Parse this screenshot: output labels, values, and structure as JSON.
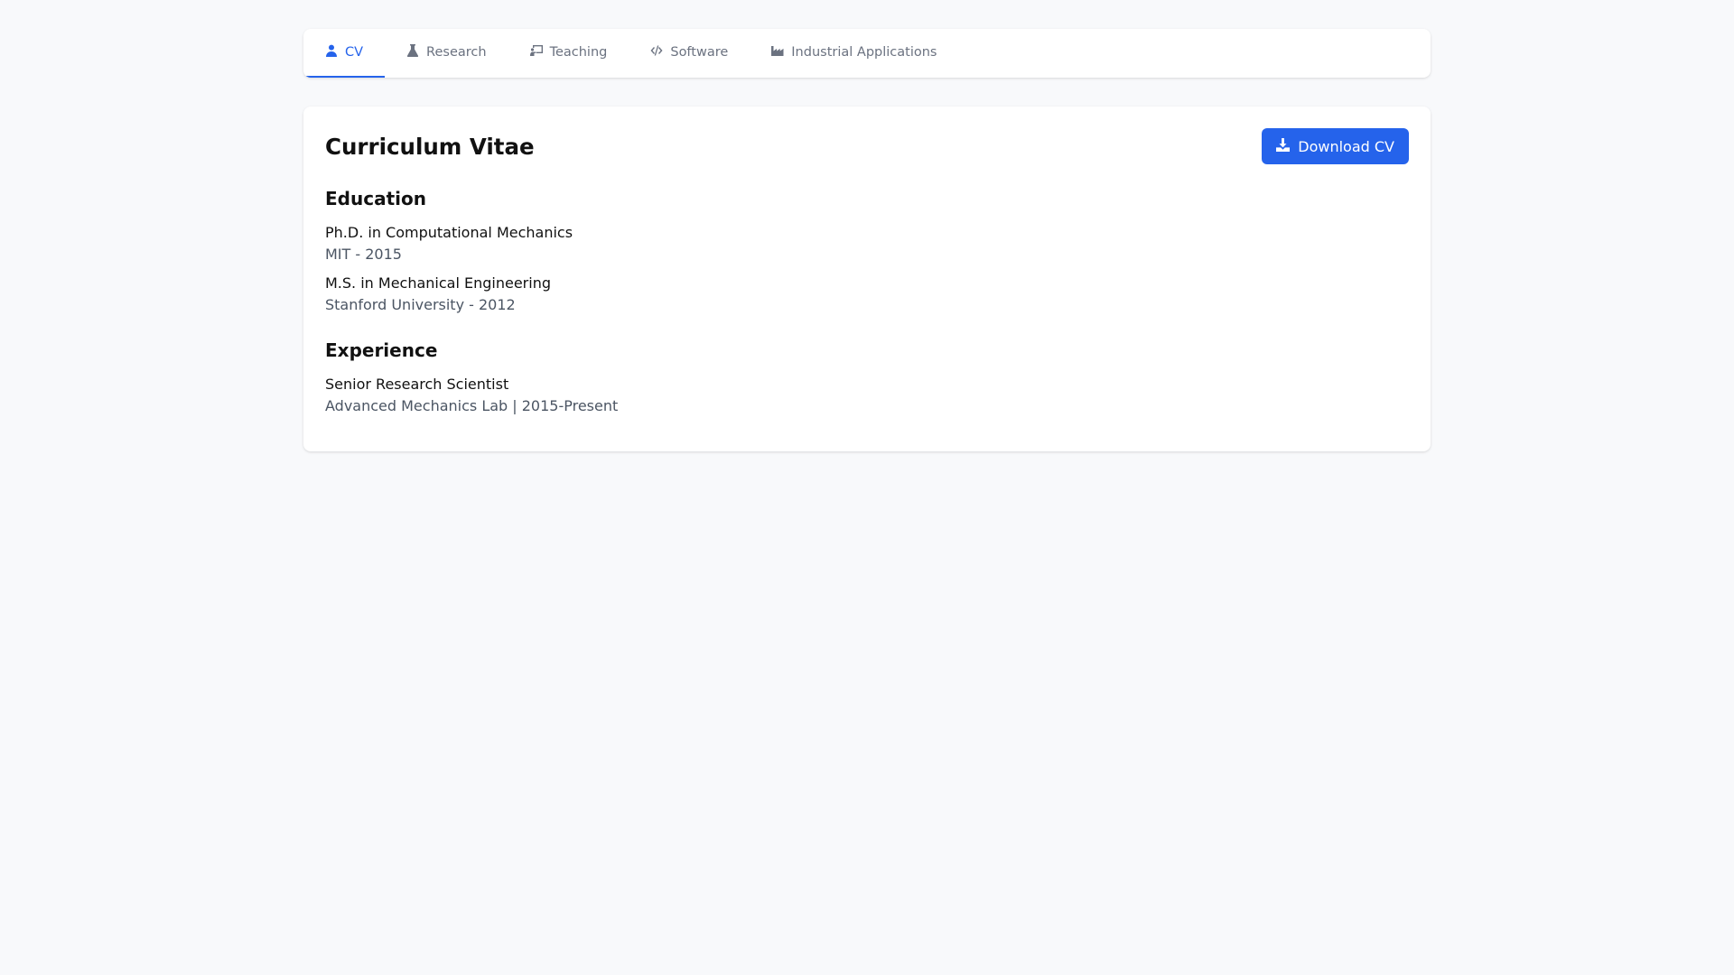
{
  "tabs": [
    {
      "label": "CV",
      "icon": "user-icon",
      "active": true
    },
    {
      "label": "Research",
      "icon": "flask-icon",
      "active": false
    },
    {
      "label": "Teaching",
      "icon": "chalkboard-teacher-icon",
      "active": false
    },
    {
      "label": "Software",
      "icon": "code-icon",
      "active": false
    },
    {
      "label": "Industrial Applications",
      "icon": "industry-icon",
      "active": false
    }
  ],
  "cv": {
    "title": "Curriculum Vitae",
    "download_label": "Download CV",
    "education": {
      "heading": "Education",
      "items": [
        {
          "title": "Ph.D. in Computational Mechanics",
          "sub": "MIT - 2015"
        },
        {
          "title": "M.S. in Mechanical Engineering",
          "sub": "Stanford University - 2012"
        }
      ]
    },
    "experience": {
      "heading": "Experience",
      "items": [
        {
          "title": "Senior Research Scientist",
          "sub": "Advanced Mechanics Lab | 2015-Present"
        }
      ]
    }
  },
  "colors": {
    "accent": "#2563eb",
    "background": "#f8f9fb",
    "muted_text": "#6b7280"
  }
}
